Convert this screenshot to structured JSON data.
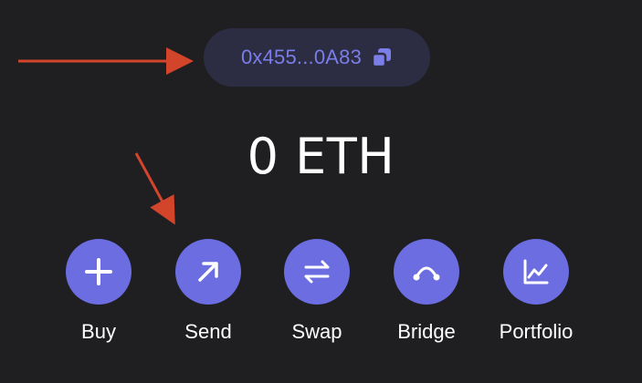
{
  "wallet": {
    "address": "0x455...0A83",
    "balance": "0 ETH"
  },
  "actions": [
    {
      "label": "Buy",
      "icon": "plus-icon"
    },
    {
      "label": "Send",
      "icon": "arrow-up-right-icon"
    },
    {
      "label": "Swap",
      "icon": "swap-arrows-icon"
    },
    {
      "label": "Bridge",
      "icon": "bridge-icon"
    },
    {
      "label": "Portfolio",
      "icon": "chart-line-icon"
    }
  ],
  "colors": {
    "background": "#1f1f22",
    "accent": "#6b6de0",
    "address_pill": "#2c2d42",
    "address_text": "#7b7de8",
    "annotation_arrow": "#d2452a"
  }
}
